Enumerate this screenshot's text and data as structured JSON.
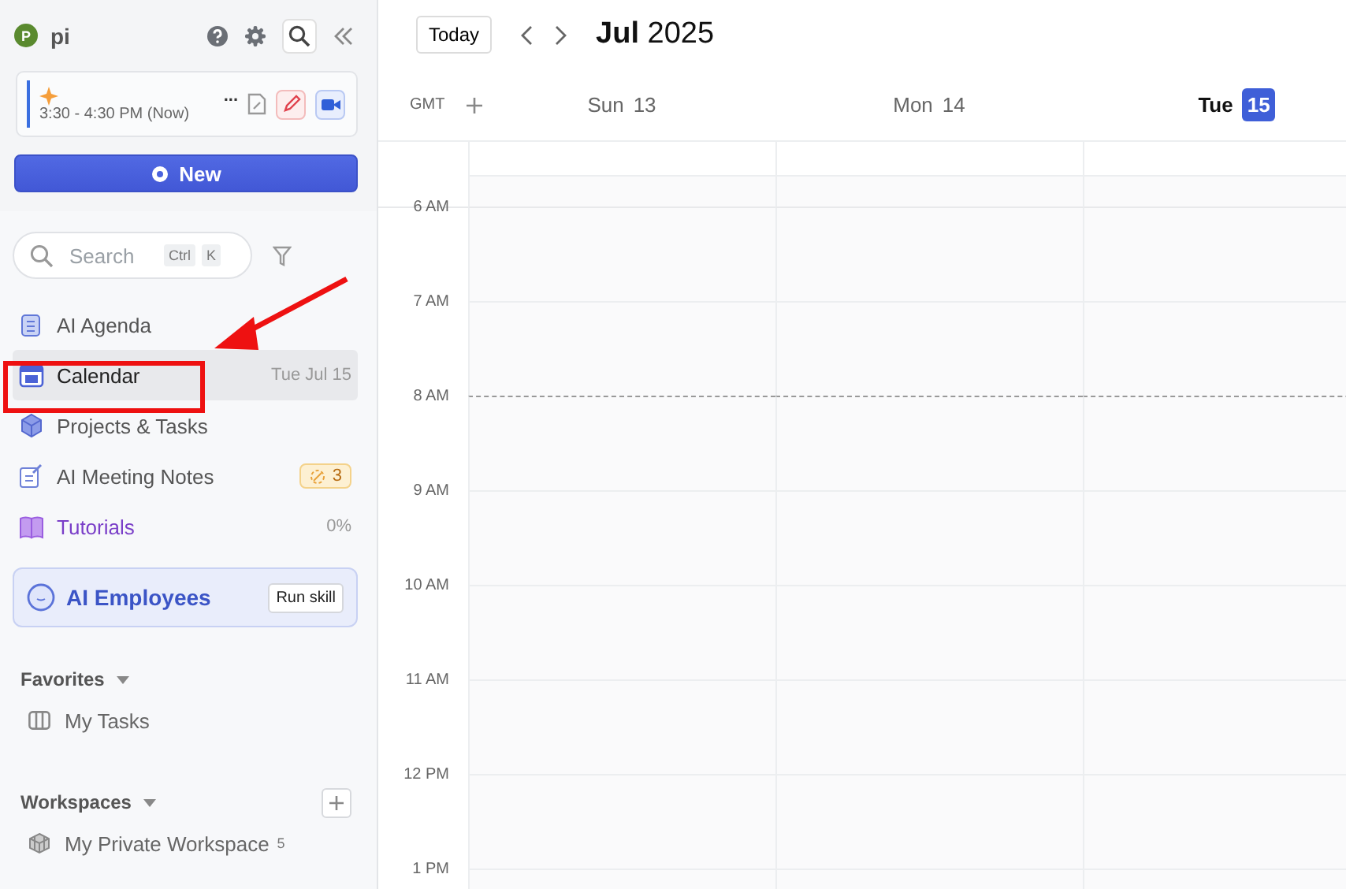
{
  "user": {
    "avatar": "P",
    "name": "pi"
  },
  "current_event": {
    "title": "...",
    "time": "3:30 - 4:30 PM (Now)"
  },
  "new_button": "New",
  "search": {
    "placeholder": "Search",
    "shortcut": [
      "Ctrl",
      "K"
    ]
  },
  "nav": [
    {
      "kind": "agenda",
      "label": "AI Agenda",
      "selected": false
    },
    {
      "kind": "calendar",
      "label": "Calendar",
      "selected": true,
      "meta": "Tue Jul 15"
    },
    {
      "kind": "projects",
      "label": "Projects & Tasks",
      "selected": false
    },
    {
      "kind": "notes",
      "label": "AI Meeting Notes",
      "selected": false,
      "badge": "3"
    },
    {
      "kind": "tutorials",
      "label": "Tutorials",
      "selected": false,
      "meta": "0%"
    }
  ],
  "ai_employees": {
    "label": "AI Employees",
    "button": "Run skill"
  },
  "favorites": {
    "title": "Favorites",
    "items": [
      {
        "label": "My Tasks"
      }
    ]
  },
  "workspaces": {
    "title": "Workspaces",
    "items": [
      {
        "label": "My Private Workspace",
        "count": "5"
      }
    ]
  },
  "toolbar": {
    "today": "Today",
    "month": "Jul",
    "year": "2025"
  },
  "calendar": {
    "timezone": "GMT",
    "days": [
      {
        "weekday": "Sun",
        "date": "13",
        "today": false
      },
      {
        "weekday": "Mon",
        "date": "14",
        "today": false
      },
      {
        "weekday": "Tue",
        "date": "15",
        "today": true
      }
    ],
    "hours": [
      "6 AM",
      "7 AM",
      "8 AM",
      "9 AM",
      "10 AM",
      "11 AM",
      "12 PM",
      "1 PM"
    ]
  }
}
